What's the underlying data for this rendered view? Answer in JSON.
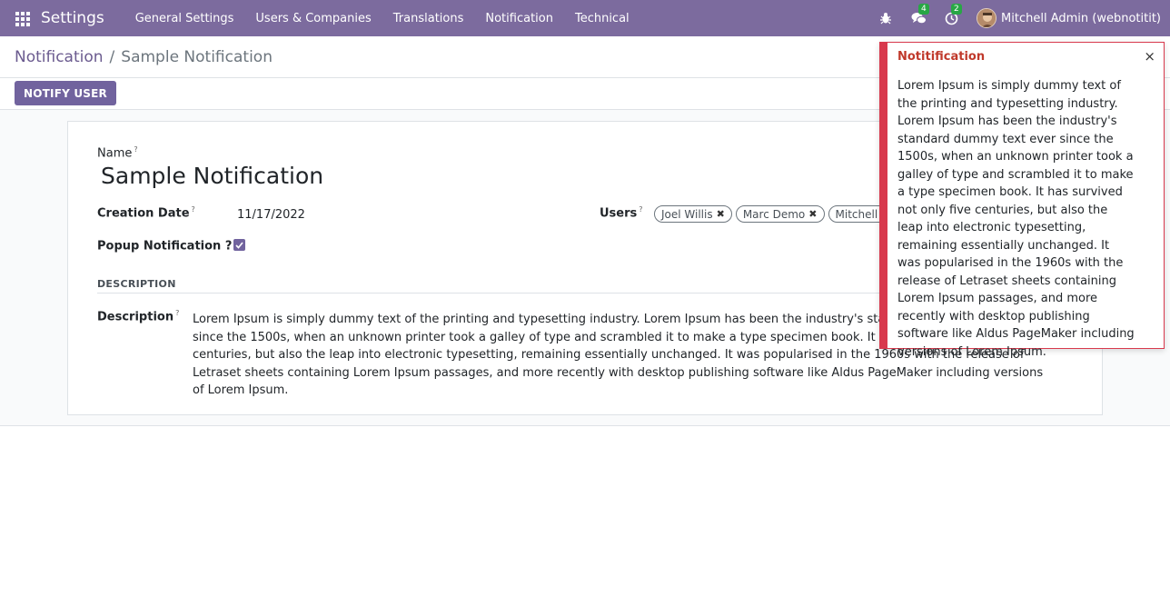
{
  "navbar": {
    "brand": "Settings",
    "menu": [
      "General Settings",
      "Users & Companies",
      "Translations",
      "Notification",
      "Technical"
    ],
    "messages_badge": "4",
    "activities_badge": "2",
    "user": "Mitchell Admin (webnotitit)",
    "color": "#7c6b9e"
  },
  "breadcrumb": {
    "parent": "Notification",
    "separator": "/",
    "current": "Sample Notification"
  },
  "toolbar": {
    "notify_label": "NOTIFY USER"
  },
  "form": {
    "name_label": "Name",
    "name_value": "Sample Notification",
    "creation_date_label": "Creation Date",
    "creation_date_value": "11/17/2022",
    "popup_label": "Popup Notification ?",
    "popup_checked": true,
    "users_label": "Users",
    "users": [
      "Joel Willis",
      "Marc Demo",
      "Mitchell Admin"
    ],
    "section_title": "DESCRIPTION",
    "description_label": "Description",
    "description_value": "Lorem Ipsum is simply dummy text of the printing and typesetting industry. Lorem Ipsum has been the industry's standard dummy text ever since the 1500s, when an unknown printer took a galley of type and scrambled it to make a type specimen book. It has survived not only five centuries, but also the leap into electronic typesetting, remaining essentially unchanged. It was popularised in the 1960s with the release of Letraset sheets containing Lorem Ipsum passages, and more recently with desktop publishing software like Aldus PageMaker including versions of Lorem Ipsum."
  },
  "notification": {
    "title": "Notitification",
    "close": "×",
    "body": "Lorem Ipsum is simply dummy text of the printing and typesetting industry. Lorem Ipsum has been the industry's standard dummy text ever since the 1500s, when an unknown printer took a galley of type and scrambled it to make a type specimen book. It has survived not only five centuries, but also the leap into electronic typesetting, remaining essentially unchanged. It was popularised in the 1960s with the release of Letraset sheets containing Lorem Ipsum passages, and more recently with desktop publishing software like Aldus PageMaker including versions of Lorem Ipsum.",
    "color": "#d8394d"
  }
}
